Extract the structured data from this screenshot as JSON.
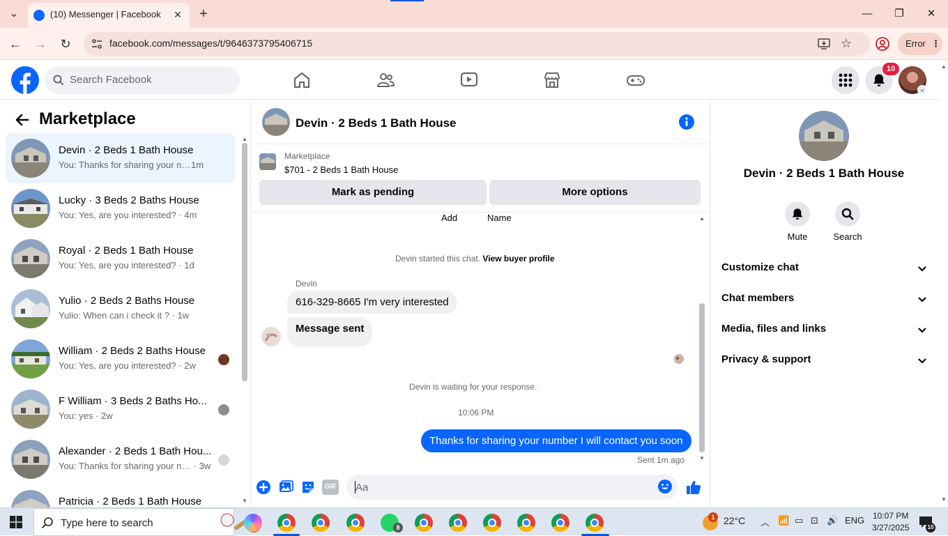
{
  "browser": {
    "tab_title": "(10) Messenger | Facebook",
    "url": "facebook.com/messages/t/9646373795406715",
    "error_label": "Error"
  },
  "facebook": {
    "search_placeholder": "Search Facebook",
    "notification_count": "10"
  },
  "sidebar": {
    "title": "Marketplace",
    "conversations": [
      {
        "name": "Devin · 2 Beds 1 Bath House",
        "preview": "You: Thanks for sharing your numb...",
        "time": "1m"
      },
      {
        "name": "Lucky · 3 Beds 2 Baths House",
        "preview": "You: Yes, are you interested?",
        "time": "4m"
      },
      {
        "name": "Royal · 2 Beds 1 Bath House",
        "preview": "You: Yes, are you interested?",
        "time": "1d"
      },
      {
        "name": "Yulio · 2 Beds 2 Baths House",
        "preview": "Yulio: When can i check it ?",
        "time": "1w"
      },
      {
        "name": "William · 2 Beds 2 Baths House",
        "preview": "You: Yes, are you interested?",
        "time": "2w"
      },
      {
        "name": "F William · 3 Beds 2 Baths Ho...",
        "preview": "You: yes",
        "time": "2w"
      },
      {
        "name": "Alexander · 2 Beds 1 Bath Hou...",
        "preview": "You: Thanks for sharing your nu...",
        "time": "3w"
      },
      {
        "name": "Patricia · 2 Beds 1 Bath House",
        "preview": "",
        "time": ""
      }
    ]
  },
  "chat": {
    "title": "Devin · 2 Beds 1 Bath House",
    "marketplace_label": "Marketplace",
    "listing": "$701 - 2 Beds 1 Bath House",
    "mark_pending": "Mark as pending",
    "more_options": "More options",
    "partial_top_left": "Add",
    "partial_top_right": "Name",
    "started_text": "Devin started this chat.",
    "buyer_profile_link": "View buyer profile",
    "sender_name": "Devin",
    "msg_in_1": "616-329-8665 I'm very interested",
    "msg_in_2": "Message sent",
    "waiting_text": "Devin is waiting for your response.",
    "timestamp": "10:06 PM",
    "msg_out": "Thanks for sharing your number I will contact you soon",
    "sent_status": "Sent 1m ago",
    "input_placeholder": "Aa",
    "gif_label": "GIF"
  },
  "right_panel": {
    "name": "Devin · 2 Beds 1 Bath House",
    "mute_label": "Mute",
    "search_label": "Search",
    "sections": [
      "Customize chat",
      "Chat members",
      "Media, files and links",
      "Privacy & support"
    ]
  },
  "taskbar": {
    "search_placeholder": "Type here to search",
    "whatsapp_badge": "8",
    "weather_temp": "22°C",
    "language": "ENG",
    "time": "10:07 PM",
    "date": "3/27/2025",
    "notif_count": "10",
    "weather_alert": "1"
  },
  "colors": {
    "fb_blue": "#0866ff",
    "tab_strip": "#f8dcd5",
    "active_conv": "#ebf5ff",
    "badge_red": "#e41e3f"
  }
}
